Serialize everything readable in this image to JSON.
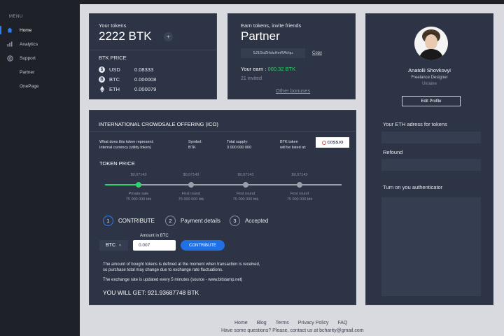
{
  "sidebar": {
    "menu_label": "MENU",
    "items": [
      {
        "label": "Home"
      },
      {
        "label": "Analytics"
      },
      {
        "label": "Support"
      },
      {
        "label": "Partner"
      },
      {
        "label": "OnePage"
      }
    ]
  },
  "tokens_card": {
    "title": "Your tokens",
    "amount": "2222 BTK",
    "plus": "+",
    "price_title": "BTK PRICE",
    "prices": [
      {
        "currency": "USD",
        "value": "0.08333"
      },
      {
        "currency": "BTC",
        "value": "0.000008"
      },
      {
        "currency": "ETH",
        "value": "0.000079"
      }
    ]
  },
  "partner_card": {
    "subtitle": "Earn tokens, invite friends",
    "title": "Partner",
    "ref_code": "5J1GoZHolcHmRAVqu",
    "copy_label": "Copy",
    "earn_label": "Your earn :",
    "earn_value": "000.32 BTK",
    "invited": "21 invited",
    "other_bonuses": "Other bonuses"
  },
  "profile_card": {
    "name": "Anatolii Shovkovyi",
    "role": "Freelance Designer",
    "country": "Ukraine",
    "edit_button": "Edit Profile",
    "eth_label": "Your ETH adress for tokens",
    "refound_label": "Refound",
    "auth_label": "Turn on you authenticator"
  },
  "ico_card": {
    "title": "INTERNATIONAL CROWDSALE OFFERING (ICO)",
    "info": [
      {
        "label": "What does this token represent:",
        "value": "Internal currency (utility token)"
      },
      {
        "label": "Symbol:",
        "value": "BTK"
      },
      {
        "label": "Total supply:",
        "value": "3 000 000 000"
      },
      {
        "label": "BTK token",
        "value": "will be listed at:"
      }
    ],
    "exchange_logo": "COSS.IO",
    "token_price_title": "TOKEN PRICE",
    "price_steps": [
      {
        "price": "$0,07143",
        "round": "Private sale",
        "amount": "75 000 000 btk"
      },
      {
        "price": "$0,07143",
        "round": "First round",
        "amount": "75 000 000 btk"
      },
      {
        "price": "$0,07143",
        "round": "First round",
        "amount": "75 000 000 btk"
      },
      {
        "price": "$0,07143",
        "round": "First round",
        "amount": "75 000 000 btk"
      }
    ],
    "steps": [
      {
        "num": "1",
        "label": "CONTRIBUTE"
      },
      {
        "num": "2",
        "label": "Payment details"
      },
      {
        "num": "3",
        "label": "Accepted"
      }
    ],
    "amount_label": "Amount in BTC",
    "currency_select": "BTC",
    "amount_value": "0.007",
    "contribute_button": "CONTRIBUTE",
    "note_1a": "The amount of bought tokens is defined at the moment when transaction is received,",
    "note_1b": "so purchase total may change due to exchange rate fluctuations.",
    "note_2": "The exchange rate is updated every 5 minutes (source - www.bitstamp.net)",
    "result": "YOU WILL GET: 921.93687748 BTK"
  },
  "footer": {
    "links": [
      "Home",
      "Blog",
      "Terms",
      "Privacy Policy",
      "FAQ"
    ],
    "contact": "Have some questions? Please, contact us at bcharity@gmail.com"
  },
  "colors": {
    "accent": "#2f7df6",
    "green": "#2ed26d",
    "card": "#2d3445",
    "sidebar": "#1e2128",
    "background": "#d9dadf"
  }
}
